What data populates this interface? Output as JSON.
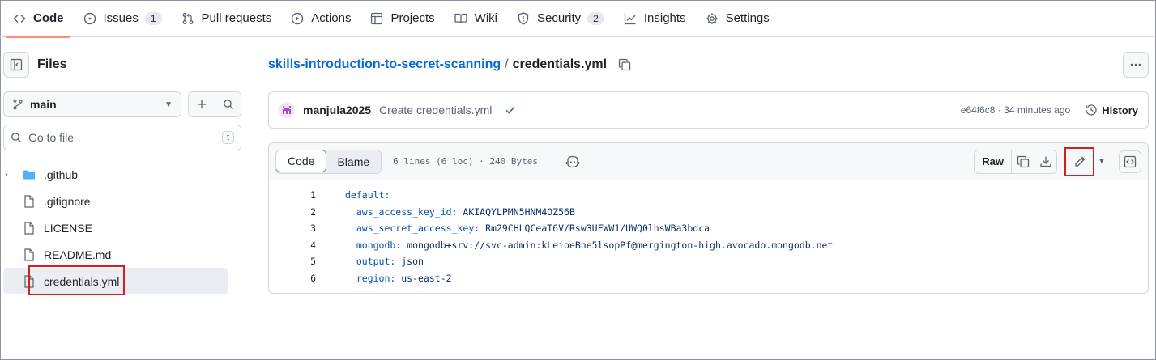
{
  "repo_nav": {
    "tabs": [
      {
        "label": "Code",
        "icon": "code-icon",
        "active": true
      },
      {
        "label": "Issues",
        "icon": "issue-icon",
        "count": "1"
      },
      {
        "label": "Pull requests",
        "icon": "pull-request-icon"
      },
      {
        "label": "Actions",
        "icon": "play-icon"
      },
      {
        "label": "Projects",
        "icon": "table-icon"
      },
      {
        "label": "Wiki",
        "icon": "book-icon"
      },
      {
        "label": "Security",
        "icon": "shield-icon",
        "count": "2"
      },
      {
        "label": "Insights",
        "icon": "graph-icon"
      },
      {
        "label": "Settings",
        "icon": "gear-icon"
      }
    ]
  },
  "sidebar": {
    "title": "Files",
    "branch": "main",
    "goto_placeholder": "Go to file",
    "goto_shortcut": "t",
    "tree": [
      {
        "name": ".github",
        "type": "folder"
      },
      {
        "name": ".gitignore",
        "type": "file"
      },
      {
        "name": "LICENSE",
        "type": "file"
      },
      {
        "name": "README.md",
        "type": "file"
      },
      {
        "name": "credentials.yml",
        "type": "file",
        "selected": true
      }
    ]
  },
  "breadcrumb": {
    "repo": "skills-introduction-to-secret-scanning",
    "separator": "/",
    "file": "credentials.yml"
  },
  "commit": {
    "author": "manjula2025",
    "message": "Create credentials.yml",
    "meta": "e64f6c8 · 34 minutes ago",
    "history_label": "History"
  },
  "file_view": {
    "tab_code": "Code",
    "tab_blame": "Blame",
    "info": "6 lines (6 loc) · 240 Bytes",
    "raw_label": "Raw",
    "lines": [
      {
        "num": "1",
        "key": "default:",
        "value": ""
      },
      {
        "num": "2",
        "key": "  aws_access_key_id:",
        "value": " AKIAQYLPMN5HNM4OZ56B"
      },
      {
        "num": "3",
        "key": "  aws_secret_access_key:",
        "value": " Rm29CHLQCeaT6V/Rsw3UFWW1/UWQ0lhsWBa3bdca"
      },
      {
        "num": "4",
        "key": "  mongodb:",
        "value": " mongodb+srv://svc-admin:kLeioeBne5lsopPf@mergington-high.avocado.mongodb.net"
      },
      {
        "num": "5",
        "key": "  output:",
        "value": " json"
      },
      {
        "num": "6",
        "key": "  region:",
        "value": " us-east-2"
      }
    ]
  },
  "colors": {
    "link": "#0969da",
    "highlight_box": "#d12020",
    "active_tab_underline": "#fd8c73",
    "success": "#1a7f37"
  }
}
